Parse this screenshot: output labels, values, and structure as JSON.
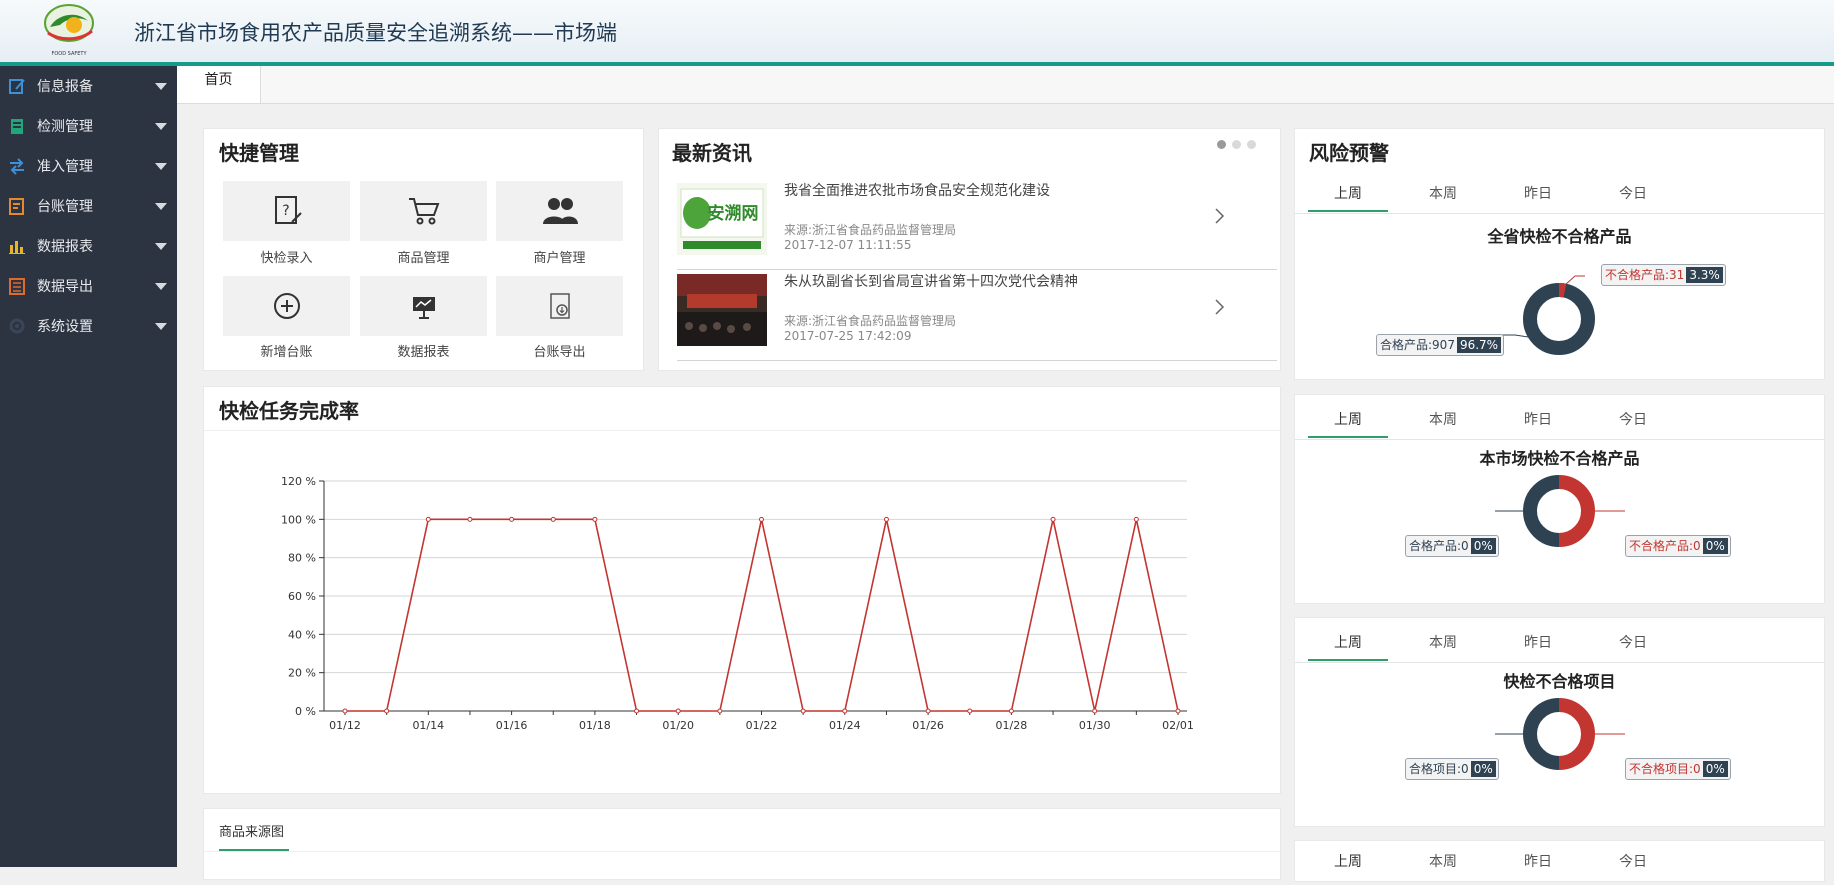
{
  "header": {
    "title": "浙江省市场食用农产品质量安全追溯系统——市场端",
    "logo_text": "FOOD SAFETY"
  },
  "sidebar": {
    "items": [
      {
        "label": "信息报备",
        "icon": "edit-icon",
        "color": "#3d8fd6"
      },
      {
        "label": "检测管理",
        "icon": "document-icon",
        "color": "#1fa67a"
      },
      {
        "label": "准入管理",
        "icon": "swap-arrows-icon",
        "color": "#3d8fd6"
      },
      {
        "label": "台账管理",
        "icon": "ledger-icon",
        "color": "#e58a2a"
      },
      {
        "label": "数据报表",
        "icon": "bar-chart-icon",
        "color": "#e5b52a"
      },
      {
        "label": "数据导出",
        "icon": "list-export-icon",
        "color": "#e06a2a"
      },
      {
        "label": "系统设置",
        "icon": "gear-icon",
        "color": "#3a4657"
      }
    ]
  },
  "tabs": {
    "home": "首页"
  },
  "quick": {
    "title": "快捷管理",
    "items": [
      {
        "label": "快检录入",
        "icon": "clipboard-question-icon"
      },
      {
        "label": "商品管理",
        "icon": "shopping-cart-icon"
      },
      {
        "label": "商户管理",
        "icon": "users-icon"
      },
      {
        "label": "新增台账",
        "icon": "plus-circle-icon"
      },
      {
        "label": "数据报表",
        "icon": "presentation-chart-icon"
      },
      {
        "label": "台账导出",
        "icon": "file-download-icon"
      }
    ]
  },
  "news": {
    "title": "最新资讯",
    "items": [
      {
        "title": "我省全面推进农批市场食品安全规范化建设",
        "source": "来源:浙江省食品药品监督管理局",
        "date": "2017-12-07 11:11:55",
        "thumb_text": "安溯网"
      },
      {
        "title": "朱从玖副省长到省局宣讲省第十四次党代会精神",
        "source": "来源:浙江省食品药品监督管理局",
        "date": "2017-07-25 17:42:09"
      }
    ]
  },
  "task": {
    "title": "快检任务完成率",
    "chart_data": {
      "type": "line",
      "x": [
        "01/12",
        "01/13",
        "01/14",
        "01/15",
        "01/16",
        "01/17",
        "01/18",
        "01/19",
        "01/20",
        "01/21",
        "01/22",
        "01/23",
        "01/24",
        "01/25",
        "01/26",
        "01/27",
        "01/28",
        "01/29",
        "01/30",
        "01/31",
        "02/01"
      ],
      "x_tick_labels": [
        "01/12",
        "01/14",
        "01/16",
        "01/18",
        "01/20",
        "01/22",
        "01/24",
        "01/26",
        "01/28",
        "01/30",
        "02/01"
      ],
      "values": [
        0,
        0,
        100,
        100,
        100,
        100,
        100,
        0,
        0,
        0,
        100,
        0,
        0,
        100,
        0,
        0,
        0,
        100,
        0,
        100,
        0
      ],
      "y_ticks": [
        "0 %",
        "20 %",
        "40 %",
        "60 %",
        "80 %",
        "100 %",
        "120 %"
      ],
      "ylim": [
        0,
        120
      ],
      "color": "#c23531",
      "grid": true
    }
  },
  "source_card": {
    "tab_label": "商品来源图"
  },
  "risk": {
    "title": "风险预警",
    "periods": [
      "上周",
      "本周",
      "昨日",
      "今日"
    ],
    "panels": [
      {
        "title": "全省快检不合格产品",
        "pass_label": "合格产品:907",
        "pass_pct": "96.7%",
        "fail_label": "不合格产品:31",
        "fail_pct": "3.3%",
        "chart_data": {
          "type": "pie",
          "labels": [
            "合格产品",
            "不合格产品"
          ],
          "values": [
            907,
            31
          ]
        }
      },
      {
        "title": "本市场快检不合格产品",
        "pass_label": "合格产品:0",
        "pass_pct": "0%",
        "fail_label": "不合格产品:0",
        "fail_pct": "0%",
        "chart_data": {
          "type": "pie",
          "labels": [
            "合格产品",
            "不合格产品"
          ],
          "values": [
            0,
            0
          ]
        }
      },
      {
        "title": "快检不合格项目",
        "pass_label": "合格项目:0",
        "pass_pct": "0%",
        "fail_label": "不合格项目:0",
        "fail_pct": "0%",
        "chart_data": {
          "type": "pie",
          "labels": [
            "合格项目",
            "不合格项目"
          ],
          "values": [
            0,
            0
          ]
        }
      }
    ]
  },
  "colors": {
    "accent": "#169b8b",
    "sidebar_bg": "#2d3441",
    "series_red": "#c23531",
    "donut_dark": "#2f4252",
    "tab_green": "#2e9e6a"
  }
}
